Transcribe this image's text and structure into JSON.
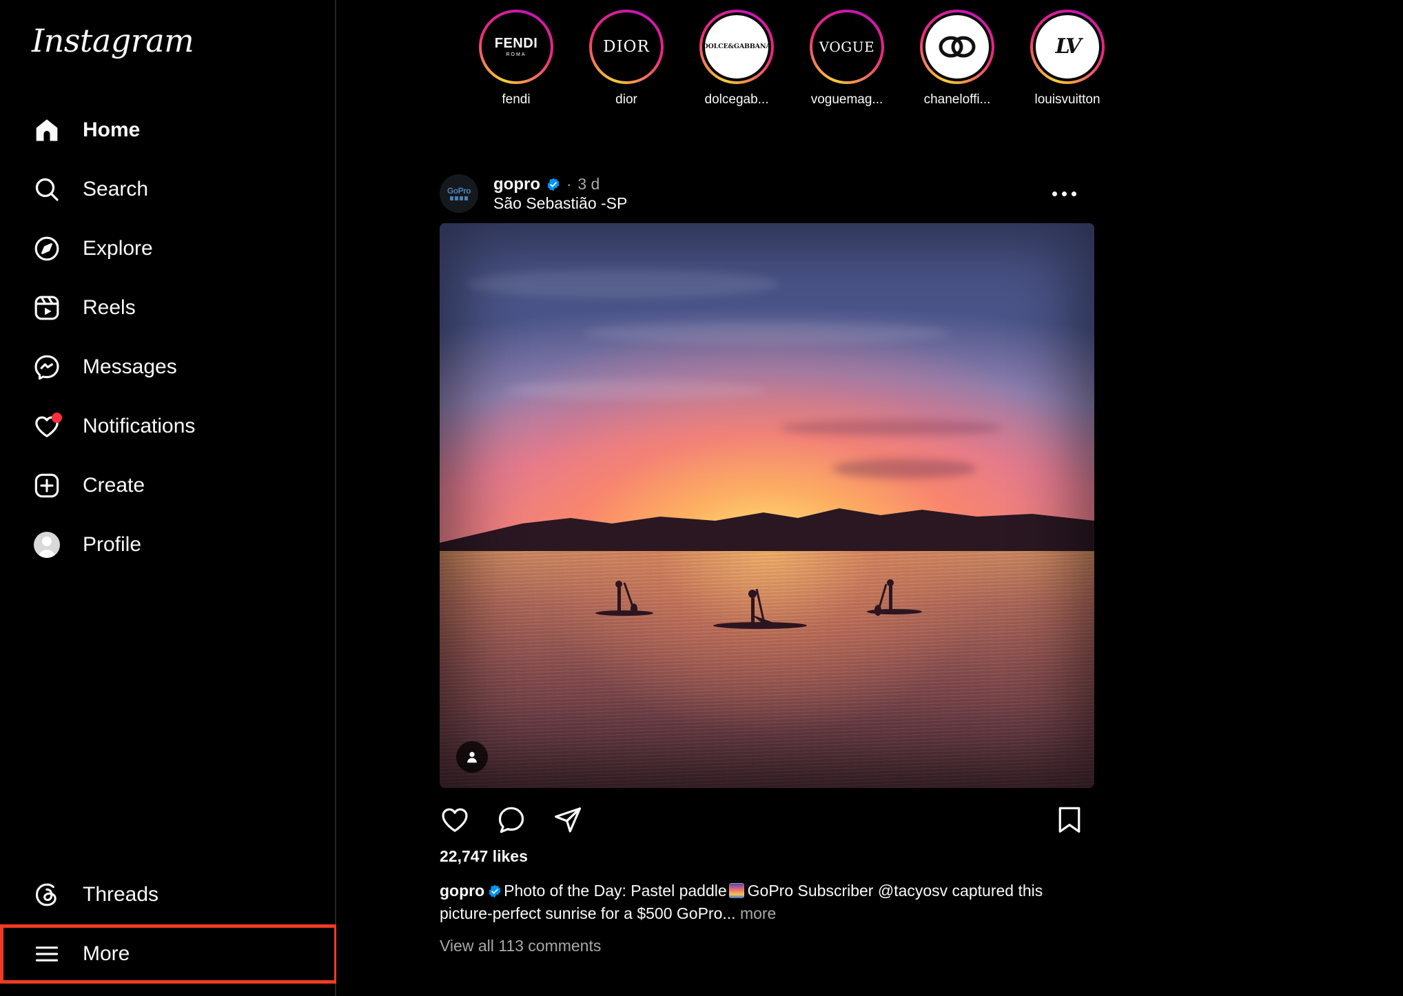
{
  "brand": {
    "logo_text": "Instagram",
    "accent_red": "#ff3040",
    "highlight_red": "#ef3c23",
    "verified_blue": "#0095f6"
  },
  "sidebar": {
    "items": [
      {
        "label": "Home",
        "icon": "home-icon",
        "active": true
      },
      {
        "label": "Search",
        "icon": "search-icon",
        "active": false
      },
      {
        "label": "Explore",
        "icon": "compass-icon",
        "active": false
      },
      {
        "label": "Reels",
        "icon": "reels-icon",
        "active": false
      },
      {
        "label": "Messages",
        "icon": "messenger-icon",
        "active": false
      },
      {
        "label": "Notifications",
        "icon": "heart-icon",
        "active": false,
        "badge": true
      },
      {
        "label": "Create",
        "icon": "plus-square-icon",
        "active": false
      },
      {
        "label": "Profile",
        "icon": "avatar-icon",
        "active": false
      }
    ],
    "bottom_items": [
      {
        "label": "Threads",
        "icon": "threads-icon",
        "highlighted": false
      },
      {
        "label": "More",
        "icon": "hamburger-icon",
        "highlighted": true
      }
    ]
  },
  "stories": [
    {
      "username": "fendi",
      "display": "fendi",
      "logo": "FENDI",
      "logo_sub": "ROMA",
      "style": "dark"
    },
    {
      "username": "dior",
      "display": "dior",
      "logo": "DIOR",
      "logo_sub": "",
      "style": "dark"
    },
    {
      "username": "dolcegabbana",
      "display": "dolcegab...",
      "logo": "DOLCE&GABBANA",
      "logo_sub": "",
      "style": "light"
    },
    {
      "username": "voguemagazine",
      "display": "voguemag...",
      "logo": "VOGUE",
      "logo_sub": "",
      "style": "dark"
    },
    {
      "username": "chanelofficial",
      "display": "chaneloffi...",
      "logo": "chanel-cc-icon",
      "logo_sub": "",
      "style": "light"
    },
    {
      "username": "louisvuitton",
      "display": "louisvuitton",
      "logo": "LV",
      "logo_sub": "",
      "style": "light"
    }
  ],
  "post": {
    "author": "gopro",
    "verified": true,
    "separator": "·",
    "timestamp": "3 d",
    "location": "São Sebastião -SP",
    "avatar_label": "GoPro",
    "menu_icon": "more-options-icon",
    "image_alt": "Three paddleboarders silhouetted on calm water at pastel sunrise",
    "tag_icon": "tagged-people-icon",
    "actions": {
      "like": "like-icon",
      "comment": "comment-icon",
      "share": "share-icon",
      "save": "save-icon"
    },
    "likes": "22,747 likes",
    "caption_author": "gopro",
    "caption_text": "Photo of the Day: Pastel paddle",
    "caption_text2": "GoPro Subscriber @tacyosv captured this picture-perfect sunrise for a $500 GoPro...",
    "caption_more": "more",
    "comments_link": "View all 113 comments"
  }
}
